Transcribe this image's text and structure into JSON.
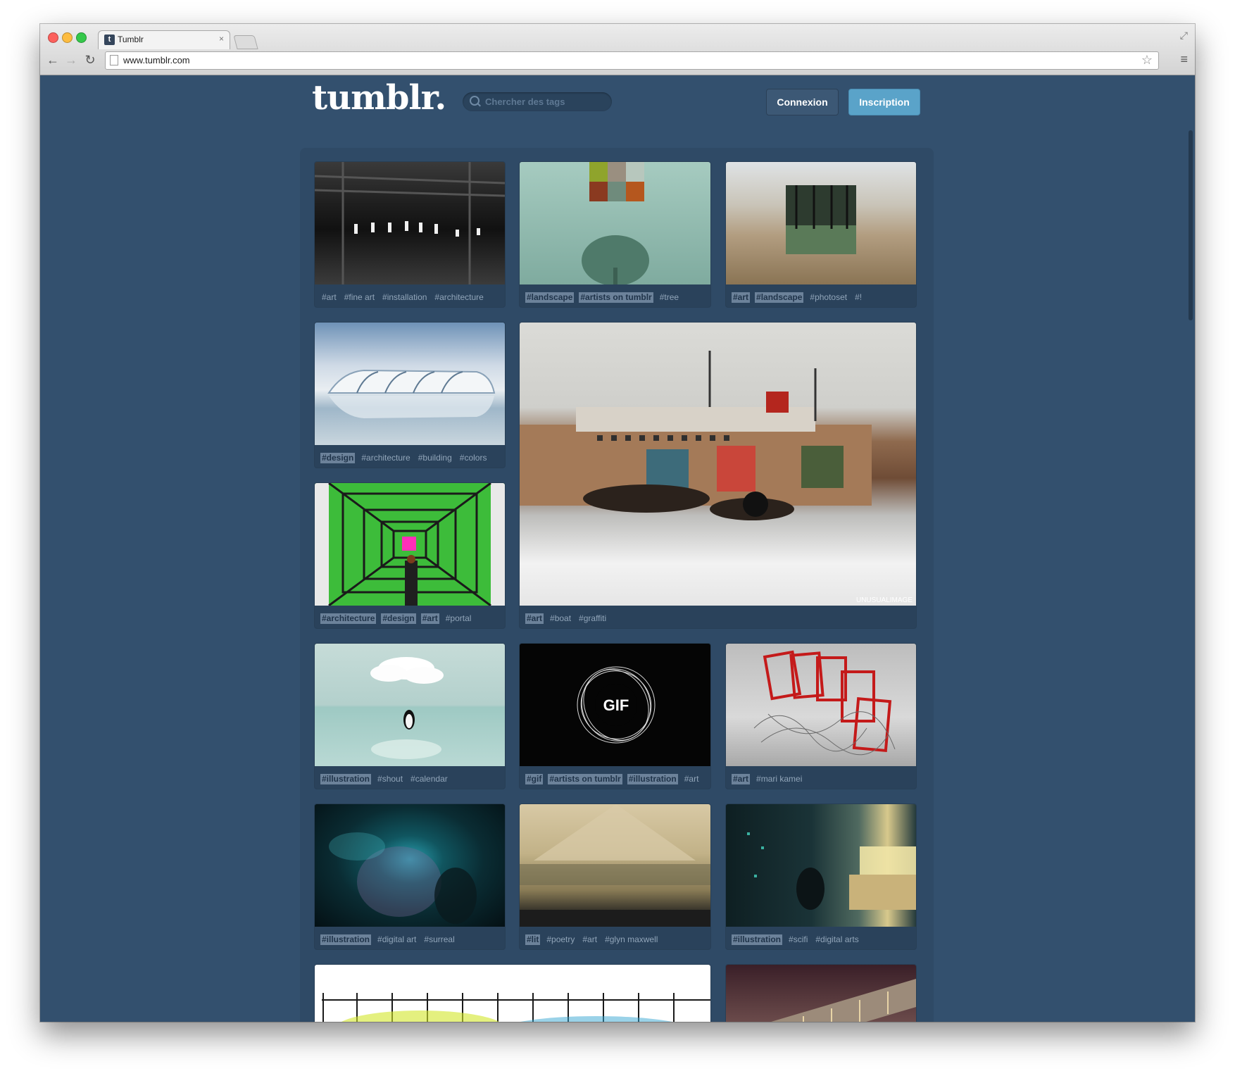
{
  "browser": {
    "tab_title": "Tumblr",
    "tab_favicon": "t",
    "tab_close": "×",
    "url": "www.tumblr.com",
    "icons": [
      "back-arrow-icon",
      "forward-arrow-icon",
      "reload-icon",
      "star-icon",
      "menu-icon",
      "fullscreen-icon"
    ]
  },
  "header": {
    "logo": "tumblr.",
    "search_placeholder": "Chercher des tags",
    "login_label": "Connexion",
    "signup_label": "Inscription"
  },
  "colors": {
    "page_bg": "#33506e",
    "signup_button": "#5aa3c9",
    "login_button": "#3c5875",
    "tag_highlight": "#6c829a"
  },
  "posts": [
    {
      "image": "warehouse interior",
      "tags": [
        {
          "t": "#art",
          "hl": false
        },
        {
          "t": "#fine art",
          "hl": false
        },
        {
          "t": "#installation",
          "hl": false
        },
        {
          "t": "#architecture",
          "hl": false
        }
      ]
    },
    {
      "image": "foggy tree with color squares",
      "tags": [
        {
          "t": "#landscape",
          "hl": true
        },
        {
          "t": "#artists on tumblr",
          "hl": true
        },
        {
          "t": "#tree",
          "hl": false
        }
      ]
    },
    {
      "image": "forest photo in desert",
      "tags": [
        {
          "t": "#art",
          "hl": true
        },
        {
          "t": "#landscape",
          "hl": true
        },
        {
          "t": "#photoset",
          "hl": false
        },
        {
          "t": "#!",
          "hl": false
        }
      ]
    },
    {
      "image": "modern building reflection",
      "tags": [
        {
          "t": "#design",
          "hl": true
        },
        {
          "t": "#architecture",
          "hl": false
        },
        {
          "t": "#building",
          "hl": false
        },
        {
          "t": "#colors",
          "hl": false
        }
      ]
    },
    {
      "image": "graffiti on abandoned ship",
      "tags": [
        {
          "t": "#art",
          "hl": true
        },
        {
          "t": "#boat",
          "hl": false
        },
        {
          "t": "#graffiti",
          "hl": false
        }
      ]
    },
    {
      "image": "green wall portal",
      "tags": [
        {
          "t": "#architecture",
          "hl": true
        },
        {
          "t": "#design",
          "hl": true
        },
        {
          "t": "#art",
          "hl": true
        },
        {
          "t": "#portal",
          "hl": false
        }
      ]
    },
    {
      "image": "penguin under cloud",
      "tags": [
        {
          "t": "#illustration",
          "hl": true
        },
        {
          "t": "#shout",
          "hl": false
        },
        {
          "t": "#calendar",
          "hl": false
        }
      ]
    },
    {
      "image": "gif sphere",
      "gif_label": "GIF",
      "tags": [
        {
          "t": "#gif",
          "hl": true
        },
        {
          "t": "#artists on tumblr",
          "hl": true
        },
        {
          "t": "#illustration",
          "hl": true
        },
        {
          "t": "#art",
          "hl": false
        }
      ]
    },
    {
      "image": "red wire cards",
      "tags": [
        {
          "t": "#art",
          "hl": true
        },
        {
          "t": "#mari kamei",
          "hl": false
        }
      ]
    },
    {
      "image": "cosmic nebula",
      "tags": [
        {
          "t": "#illustration",
          "hl": true
        },
        {
          "t": "#digital art",
          "hl": false
        },
        {
          "t": "#surreal",
          "hl": false
        }
      ]
    },
    {
      "image": "pyramid landscape",
      "tags": [
        {
          "t": "#lit",
          "hl": true
        },
        {
          "t": "#poetry",
          "hl": false
        },
        {
          "t": "#art",
          "hl": false
        },
        {
          "t": "#glyn maxwell",
          "hl": false
        }
      ]
    },
    {
      "image": "sci-fi room",
      "tags": [
        {
          "t": "#illustration",
          "hl": true
        },
        {
          "t": "#scifi",
          "hl": false
        },
        {
          "t": "#digital arts",
          "hl": false
        }
      ]
    },
    {
      "image": "watercolor grid",
      "tags": []
    },
    {
      "image": "bridge at dusk",
      "tags": []
    }
  ],
  "ship_watermark": "UNUSUALIMAGE"
}
